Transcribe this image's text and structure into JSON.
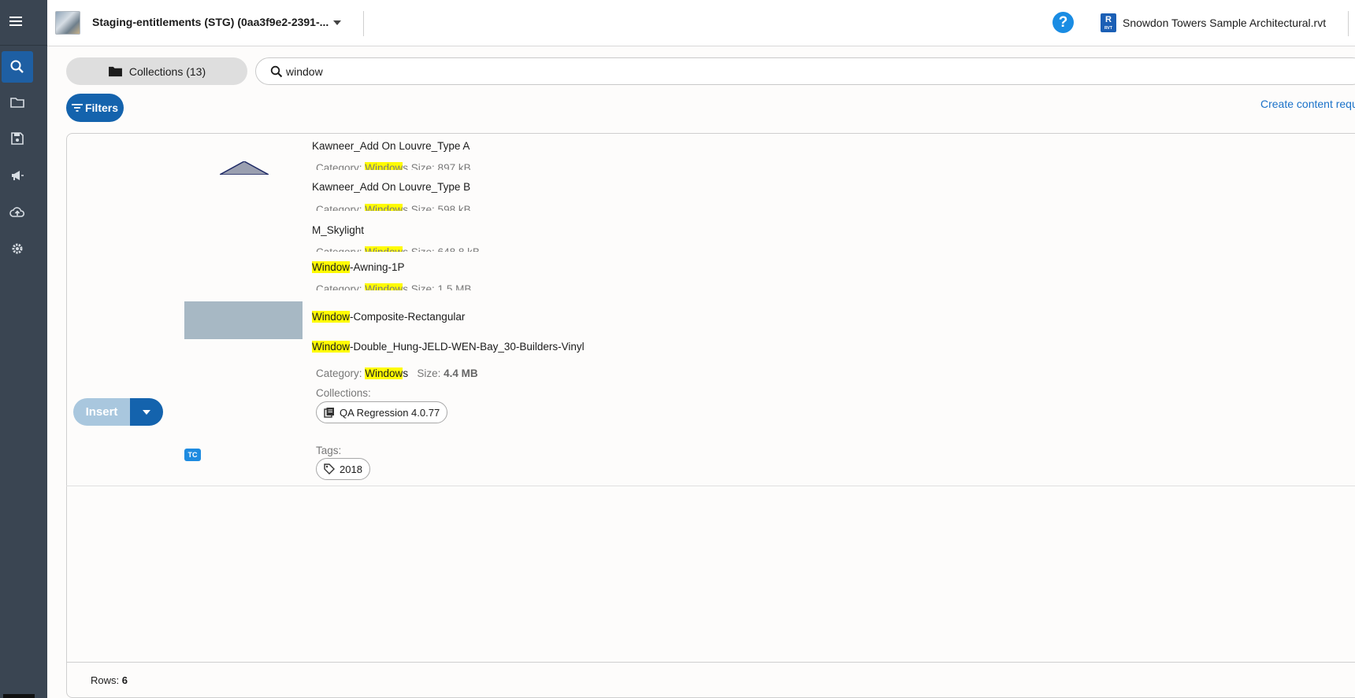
{
  "sidebar": {
    "items": [
      {
        "name": "menu",
        "icon": "hamburger-menu-icon"
      },
      {
        "name": "search",
        "icon": "search-icon",
        "active": true
      },
      {
        "name": "folder",
        "icon": "folder-icon"
      },
      {
        "name": "save",
        "icon": "save-icon"
      },
      {
        "name": "announcements",
        "icon": "megaphone-icon"
      },
      {
        "name": "upload",
        "icon": "cloud-upload-icon"
      },
      {
        "name": "settings",
        "icon": "gear-icon"
      }
    ]
  },
  "header": {
    "project_name": "Staging-entitlements (STG) (0aa3f9e2-2391-...",
    "help_glyph": "?",
    "rvt_letter": "R",
    "rvt_sub": "RVT",
    "file_name": "Snowdon Towers Sample Architectural.rvt"
  },
  "toolbar": {
    "collections_label": "Collections (13)",
    "search_value": "window",
    "filters_label": "Filters",
    "create_link": "Create content request"
  },
  "results": {
    "items": [
      {
        "title": "Kawneer_Add On Louvre_Type A",
        "meta_clip": "Category: Windows  Size: 897 kB"
      },
      {
        "title": "Kawneer_Add On Louvre_Type B",
        "meta_clip": "Category: Windows  Size: 598 kB"
      },
      {
        "title": "M_Skylight",
        "meta_clip": "Category: Windows  Size: 648.8 kB"
      },
      {
        "title_hl": "Window",
        "title_rest": "-Awning-1P",
        "meta_clip": "Category: Windows  Size: 1.5 MB"
      },
      {
        "title_hl": "Window",
        "title_rest": "-Composite-Rectangular"
      },
      {
        "title_hl": "Window",
        "title_rest": "-Double_Hung-JELD-WEN-Bay_30-Builders-Vinyl"
      }
    ],
    "expanded": {
      "category_label": "Category:",
      "category_hl": "Window",
      "category_rest": "s",
      "size_label": "Size:",
      "size_value": "4.4 MB",
      "collections_label": "Collections:",
      "collection_chip": "QA Regression 4.0.77",
      "tags_label": "Tags:",
      "tag_chip": "2018",
      "insert_label": "Insert",
      "badge": "TC"
    }
  },
  "footer": {
    "rows_label": "Rows:",
    "rows_value": "6"
  },
  "colors": {
    "sidebar_bg": "#3a4552",
    "accent": "#1463ad",
    "highlight": "#fffb02"
  }
}
